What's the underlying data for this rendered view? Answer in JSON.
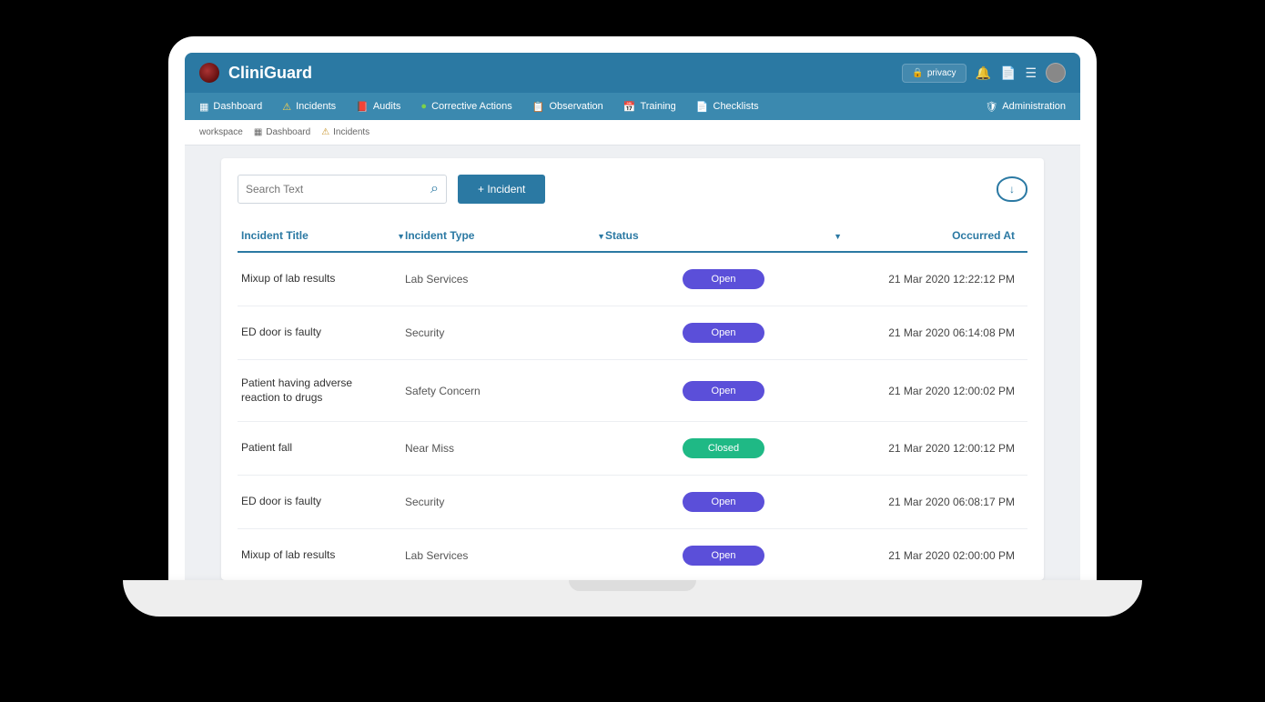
{
  "header": {
    "brand": "CliniGuard",
    "privacy_label": "privacy"
  },
  "nav": {
    "items": [
      {
        "icon": "grid",
        "label": "Dashboard"
      },
      {
        "icon": "warn",
        "label": "Incidents"
      },
      {
        "icon": "book",
        "label": "Audits"
      },
      {
        "icon": "globe",
        "label": "Corrective Actions"
      },
      {
        "icon": "clip",
        "label": "Observation"
      },
      {
        "icon": "cal",
        "label": "Training"
      },
      {
        "icon": "check",
        "label": "Checklists"
      },
      {
        "icon": "shield",
        "label": "Administration"
      }
    ]
  },
  "breadcrumb": {
    "workspace": "workspace",
    "dashboard": "Dashboard",
    "incidents": "Incidents"
  },
  "toolbar": {
    "search_placeholder": "Search Text",
    "add_label": "+ Incident"
  },
  "columns": {
    "title": "Incident Title",
    "type": "Incident Type",
    "status": "Status",
    "date": "Occurred At"
  },
  "status_labels": {
    "open": "Open",
    "closed": "Closed"
  },
  "rows": [
    {
      "title": "Mixup of lab results",
      "type": "Lab Services",
      "status": "open",
      "date": "21 Mar 2020 12:22:12 PM"
    },
    {
      "title": "ED door is faulty",
      "type": "Security",
      "status": "open",
      "date": "21 Mar 2020 06:14:08 PM"
    },
    {
      "title": "Patient having adverse reaction to drugs",
      "type": "Safety Concern",
      "status": "open",
      "date": "21 Mar 2020 12:00:02 PM"
    },
    {
      "title": "Patient fall",
      "type": "Near Miss",
      "status": "closed",
      "date": "21 Mar 2020 12:00:12 PM"
    },
    {
      "title": "ED door is faulty",
      "type": "Security",
      "status": "open",
      "date": "21 Mar 2020 06:08:17 PM"
    },
    {
      "title": "Mixup of lab results",
      "type": "Lab Services",
      "status": "open",
      "date": "21 Mar 2020 02:00:00 PM"
    }
  ]
}
